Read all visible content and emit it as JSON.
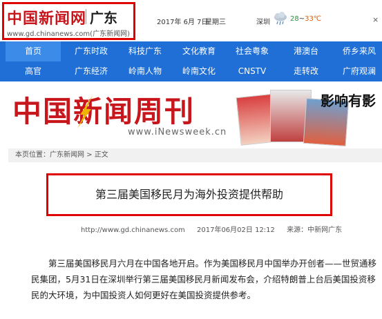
{
  "header": {
    "logo_main": "中国新闻网",
    "logo_region": "广东",
    "logo_url": "www.gd.chinanews.com(广东新闻网)",
    "date": "2017年 6月 7日",
    "weekday": "星期三",
    "city": "深圳",
    "temp_low": "28",
    "temp_sep": "~",
    "temp_high": "33℃",
    "close": "×"
  },
  "nav": {
    "row1": [
      "首页",
      "广东时政",
      "科技广东",
      "文化教育",
      "社会粤象",
      "港澳台",
      "侨乡来风"
    ],
    "row2": [
      "高官",
      "广东经济",
      "岭南人物",
      "岭南文化",
      "CNSTV",
      "走转改",
      "广府观澜"
    ]
  },
  "banner": {
    "title": "中国新闻周刊",
    "subtitle": "www.iNewsweek.cn",
    "slogan": "影响有影"
  },
  "breadcrumb": {
    "prefix": "本页位置：",
    "site": "广东新闻网",
    "sep": " > ",
    "current": "正文"
  },
  "article": {
    "title": "第三届美国移民月为海外投资提供帮助",
    "url": "http://www.gd.chinanews.com",
    "datetime": "2017年06月02日 12:12",
    "source": "来源：中新网广东",
    "body": "第三届美国移民月六月在中国各地开启。作为美国移民月中国举办开创者——世贸通移民集团，5月31日在深圳举行第三届美国移民月新闻发布会，介绍特朗普上台后美国投资移民的大环境，为中国投资人如何更好在美国投资提供参考。"
  },
  "colors": {
    "brand_red": "#c8161d",
    "highlight_red": "#e00000",
    "nav_blue": "#1f6fd6",
    "nav_active": "#3d8be8"
  }
}
